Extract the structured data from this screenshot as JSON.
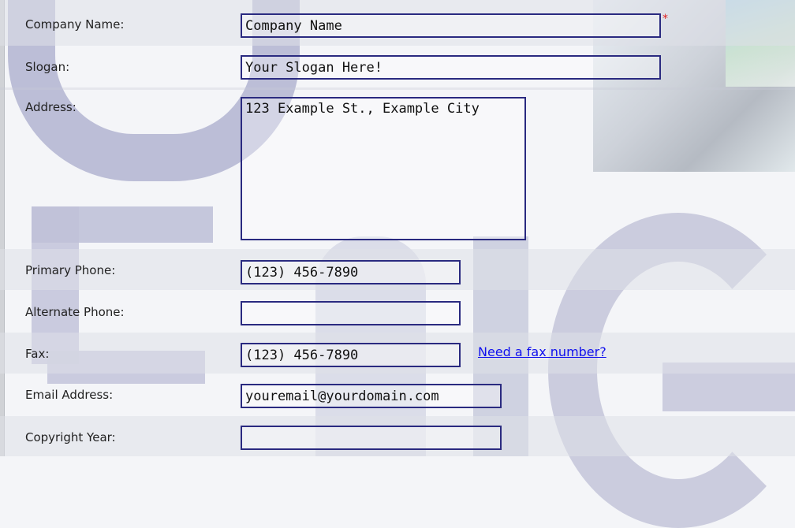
{
  "form": {
    "company_name": {
      "label": "Company Name:",
      "value": "Company Name",
      "required_marker": "*"
    },
    "slogan": {
      "label": "Slogan:",
      "value": "Your Slogan Here!"
    },
    "address": {
      "label": "Address:",
      "value": "123 Example St., Example City"
    },
    "primary_phone": {
      "label": "Primary Phone:",
      "value": "(123) 456-7890"
    },
    "alternate_phone": {
      "label": "Alternate Phone:",
      "value": ""
    },
    "fax": {
      "label": "Fax:",
      "value": "(123) 456-7890",
      "link_text": "Need a fax number?"
    },
    "email": {
      "label": "Email Address:",
      "value": "youremail@yourdomain.com"
    },
    "copyright_year": {
      "label": "Copyright Year:",
      "value": ""
    }
  },
  "colors": {
    "field_border": "#2a2a80",
    "link": "#1010ee",
    "required": "#e02020"
  }
}
